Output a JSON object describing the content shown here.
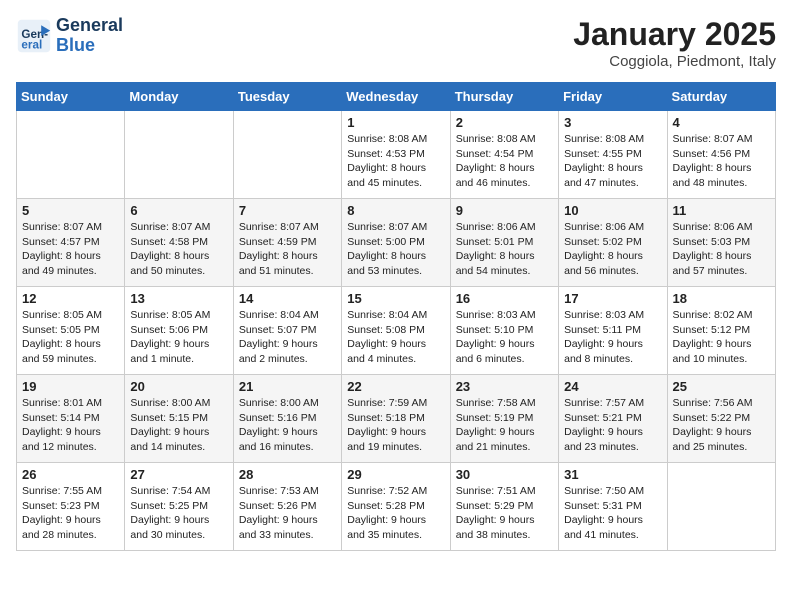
{
  "logo": {
    "line1": "General",
    "line2": "Blue"
  },
  "calendar": {
    "title": "January 2025",
    "subtitle": "Coggiola, Piedmont, Italy"
  },
  "weekdays": [
    "Sunday",
    "Monday",
    "Tuesday",
    "Wednesday",
    "Thursday",
    "Friday",
    "Saturday"
  ],
  "weeks": [
    [
      {
        "num": "",
        "info": ""
      },
      {
        "num": "",
        "info": ""
      },
      {
        "num": "",
        "info": ""
      },
      {
        "num": "1",
        "info": "Sunrise: 8:08 AM\nSunset: 4:53 PM\nDaylight: 8 hours\nand 45 minutes."
      },
      {
        "num": "2",
        "info": "Sunrise: 8:08 AM\nSunset: 4:54 PM\nDaylight: 8 hours\nand 46 minutes."
      },
      {
        "num": "3",
        "info": "Sunrise: 8:08 AM\nSunset: 4:55 PM\nDaylight: 8 hours\nand 47 minutes."
      },
      {
        "num": "4",
        "info": "Sunrise: 8:07 AM\nSunset: 4:56 PM\nDaylight: 8 hours\nand 48 minutes."
      }
    ],
    [
      {
        "num": "5",
        "info": "Sunrise: 8:07 AM\nSunset: 4:57 PM\nDaylight: 8 hours\nand 49 minutes."
      },
      {
        "num": "6",
        "info": "Sunrise: 8:07 AM\nSunset: 4:58 PM\nDaylight: 8 hours\nand 50 minutes."
      },
      {
        "num": "7",
        "info": "Sunrise: 8:07 AM\nSunset: 4:59 PM\nDaylight: 8 hours\nand 51 minutes."
      },
      {
        "num": "8",
        "info": "Sunrise: 8:07 AM\nSunset: 5:00 PM\nDaylight: 8 hours\nand 53 minutes."
      },
      {
        "num": "9",
        "info": "Sunrise: 8:06 AM\nSunset: 5:01 PM\nDaylight: 8 hours\nand 54 minutes."
      },
      {
        "num": "10",
        "info": "Sunrise: 8:06 AM\nSunset: 5:02 PM\nDaylight: 8 hours\nand 56 minutes."
      },
      {
        "num": "11",
        "info": "Sunrise: 8:06 AM\nSunset: 5:03 PM\nDaylight: 8 hours\nand 57 minutes."
      }
    ],
    [
      {
        "num": "12",
        "info": "Sunrise: 8:05 AM\nSunset: 5:05 PM\nDaylight: 8 hours\nand 59 minutes."
      },
      {
        "num": "13",
        "info": "Sunrise: 8:05 AM\nSunset: 5:06 PM\nDaylight: 9 hours\nand 1 minute."
      },
      {
        "num": "14",
        "info": "Sunrise: 8:04 AM\nSunset: 5:07 PM\nDaylight: 9 hours\nand 2 minutes."
      },
      {
        "num": "15",
        "info": "Sunrise: 8:04 AM\nSunset: 5:08 PM\nDaylight: 9 hours\nand 4 minutes."
      },
      {
        "num": "16",
        "info": "Sunrise: 8:03 AM\nSunset: 5:10 PM\nDaylight: 9 hours\nand 6 minutes."
      },
      {
        "num": "17",
        "info": "Sunrise: 8:03 AM\nSunset: 5:11 PM\nDaylight: 9 hours\nand 8 minutes."
      },
      {
        "num": "18",
        "info": "Sunrise: 8:02 AM\nSunset: 5:12 PM\nDaylight: 9 hours\nand 10 minutes."
      }
    ],
    [
      {
        "num": "19",
        "info": "Sunrise: 8:01 AM\nSunset: 5:14 PM\nDaylight: 9 hours\nand 12 minutes."
      },
      {
        "num": "20",
        "info": "Sunrise: 8:00 AM\nSunset: 5:15 PM\nDaylight: 9 hours\nand 14 minutes."
      },
      {
        "num": "21",
        "info": "Sunrise: 8:00 AM\nSunset: 5:16 PM\nDaylight: 9 hours\nand 16 minutes."
      },
      {
        "num": "22",
        "info": "Sunrise: 7:59 AM\nSunset: 5:18 PM\nDaylight: 9 hours\nand 19 minutes."
      },
      {
        "num": "23",
        "info": "Sunrise: 7:58 AM\nSunset: 5:19 PM\nDaylight: 9 hours\nand 21 minutes."
      },
      {
        "num": "24",
        "info": "Sunrise: 7:57 AM\nSunset: 5:21 PM\nDaylight: 9 hours\nand 23 minutes."
      },
      {
        "num": "25",
        "info": "Sunrise: 7:56 AM\nSunset: 5:22 PM\nDaylight: 9 hours\nand 25 minutes."
      }
    ],
    [
      {
        "num": "26",
        "info": "Sunrise: 7:55 AM\nSunset: 5:23 PM\nDaylight: 9 hours\nand 28 minutes."
      },
      {
        "num": "27",
        "info": "Sunrise: 7:54 AM\nSunset: 5:25 PM\nDaylight: 9 hours\nand 30 minutes."
      },
      {
        "num": "28",
        "info": "Sunrise: 7:53 AM\nSunset: 5:26 PM\nDaylight: 9 hours\nand 33 minutes."
      },
      {
        "num": "29",
        "info": "Sunrise: 7:52 AM\nSunset: 5:28 PM\nDaylight: 9 hours\nand 35 minutes."
      },
      {
        "num": "30",
        "info": "Sunrise: 7:51 AM\nSunset: 5:29 PM\nDaylight: 9 hours\nand 38 minutes."
      },
      {
        "num": "31",
        "info": "Sunrise: 7:50 AM\nSunset: 5:31 PM\nDaylight: 9 hours\nand 41 minutes."
      },
      {
        "num": "",
        "info": ""
      }
    ]
  ]
}
